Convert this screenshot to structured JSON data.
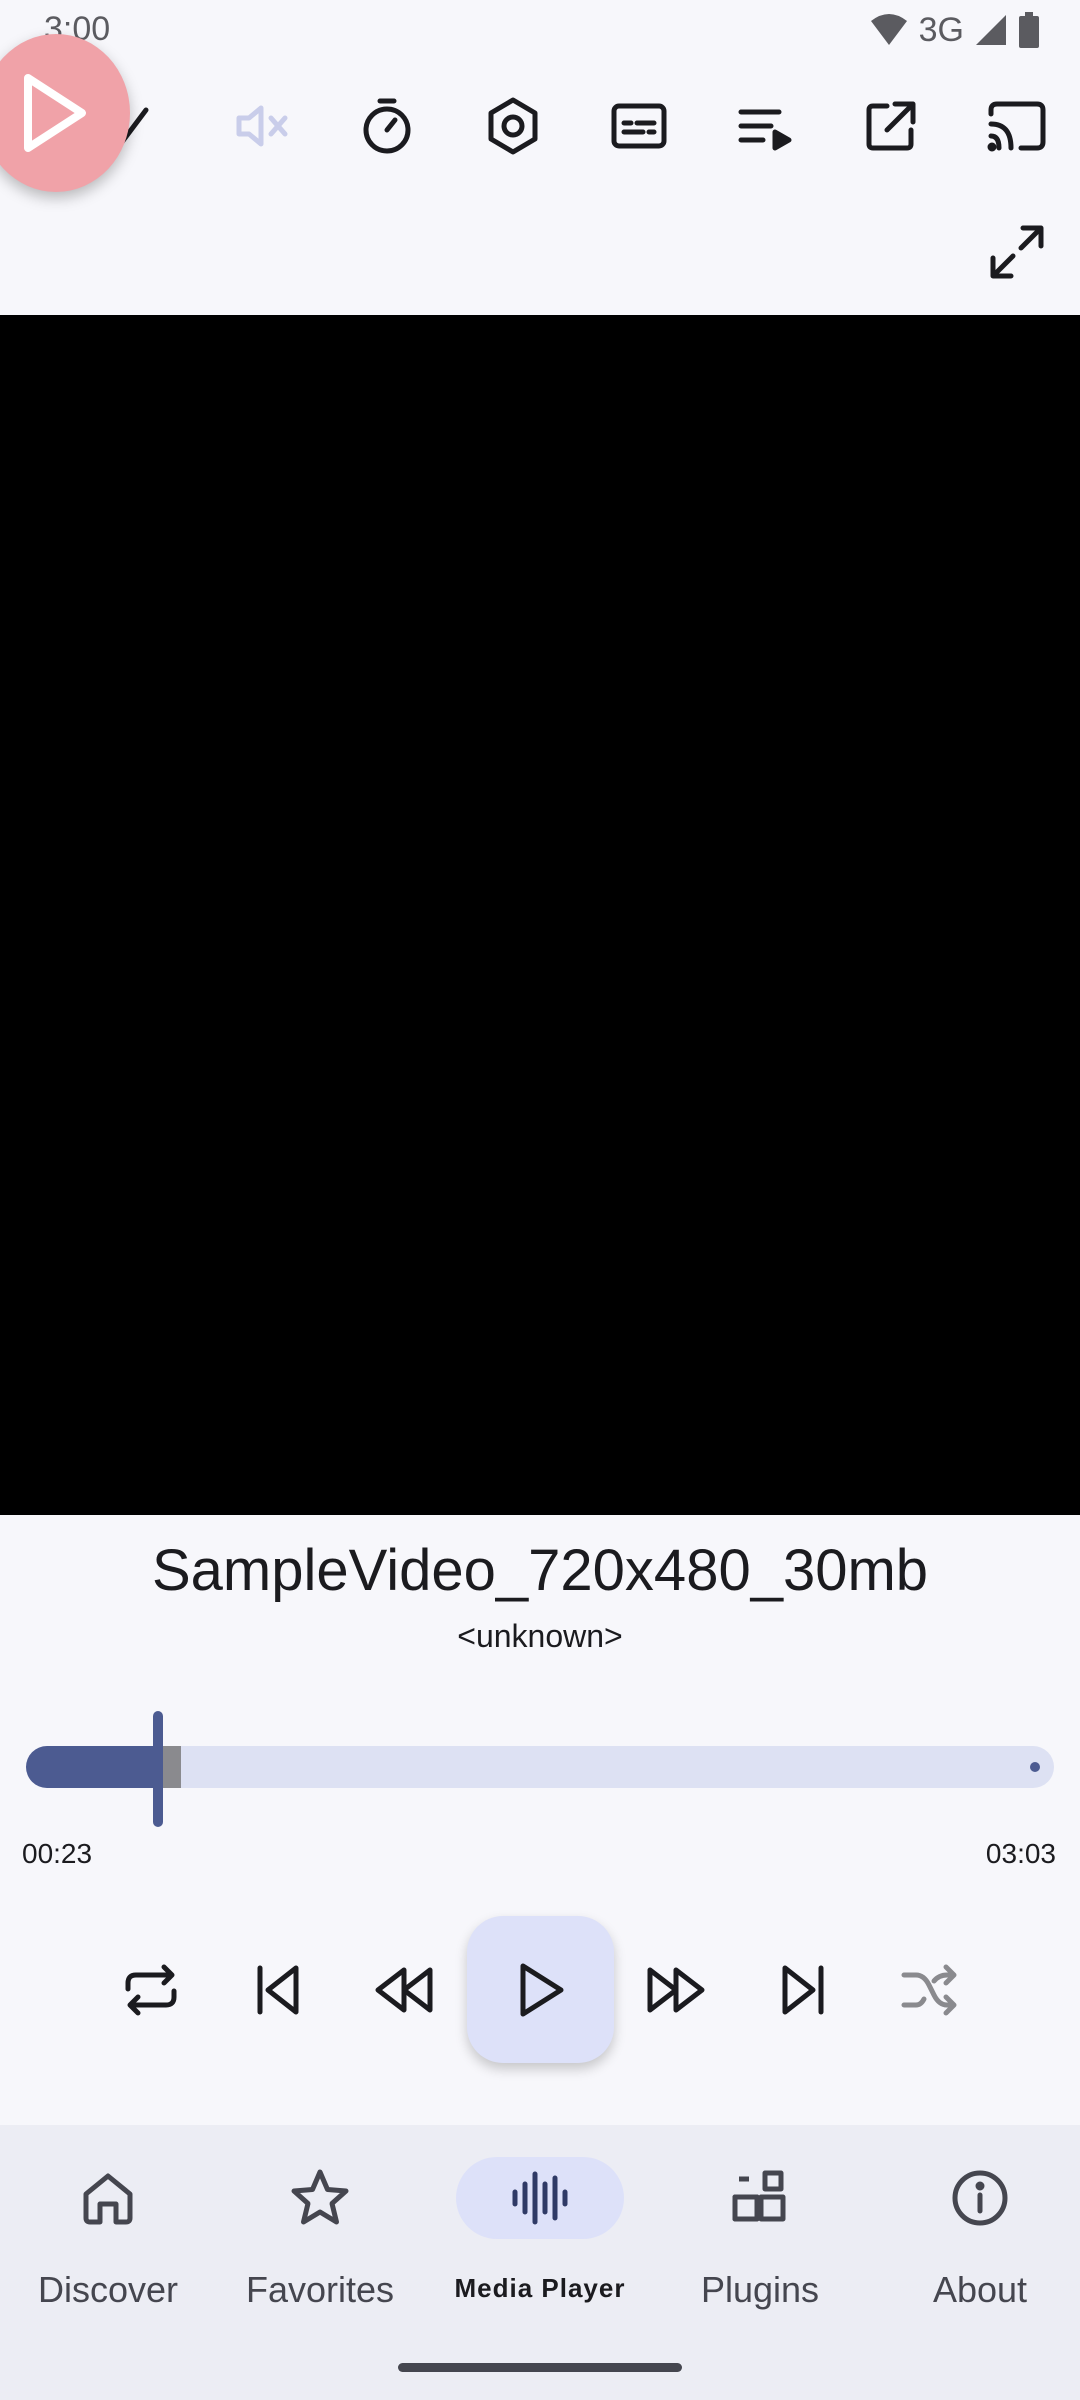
{
  "status_bar": {
    "time": "3:00",
    "network": "3G",
    "icons": [
      "wifi-icon",
      "signal-icon",
      "battery-icon"
    ]
  },
  "overlay": {
    "icon": "play-circle-icon"
  },
  "toolbar": {
    "icons": [
      "mute-icon",
      "sleep-timer-icon",
      "settings-icon",
      "subtitles-icon",
      "playlist-icon",
      "open-external-icon",
      "cast-icon",
      "fullscreen-icon"
    ]
  },
  "player": {
    "title": "SampleVideo_720x480_30mb",
    "artist": "<unknown>",
    "elapsed": "00:23",
    "duration": "03:03",
    "progress_fraction": 0.126,
    "buffered_fraction": 0.15
  },
  "controls": {
    "icons": [
      "repeat-icon",
      "skip-previous-icon",
      "rewind-icon",
      "play-icon",
      "fast-forward-icon",
      "skip-next-icon",
      "shuffle-icon"
    ]
  },
  "bottom_nav": {
    "items": [
      {
        "label": "Discover",
        "icon": "home-icon",
        "active": false
      },
      {
        "label": "Favorites",
        "icon": "star-icon",
        "active": false
      },
      {
        "label": "Media Player",
        "icon": "waveform-icon",
        "active": true
      },
      {
        "label": "Plugins",
        "icon": "widgets-icon",
        "active": false
      },
      {
        "label": "About",
        "icon": "info-icon",
        "active": false
      }
    ]
  },
  "colors": {
    "accent": "#4c5b91",
    "accent_container": "#dde1f9",
    "background": "#f7f7fb",
    "nav_background": "#ecedf4",
    "overlay_bubble": "#f0a2a8"
  }
}
